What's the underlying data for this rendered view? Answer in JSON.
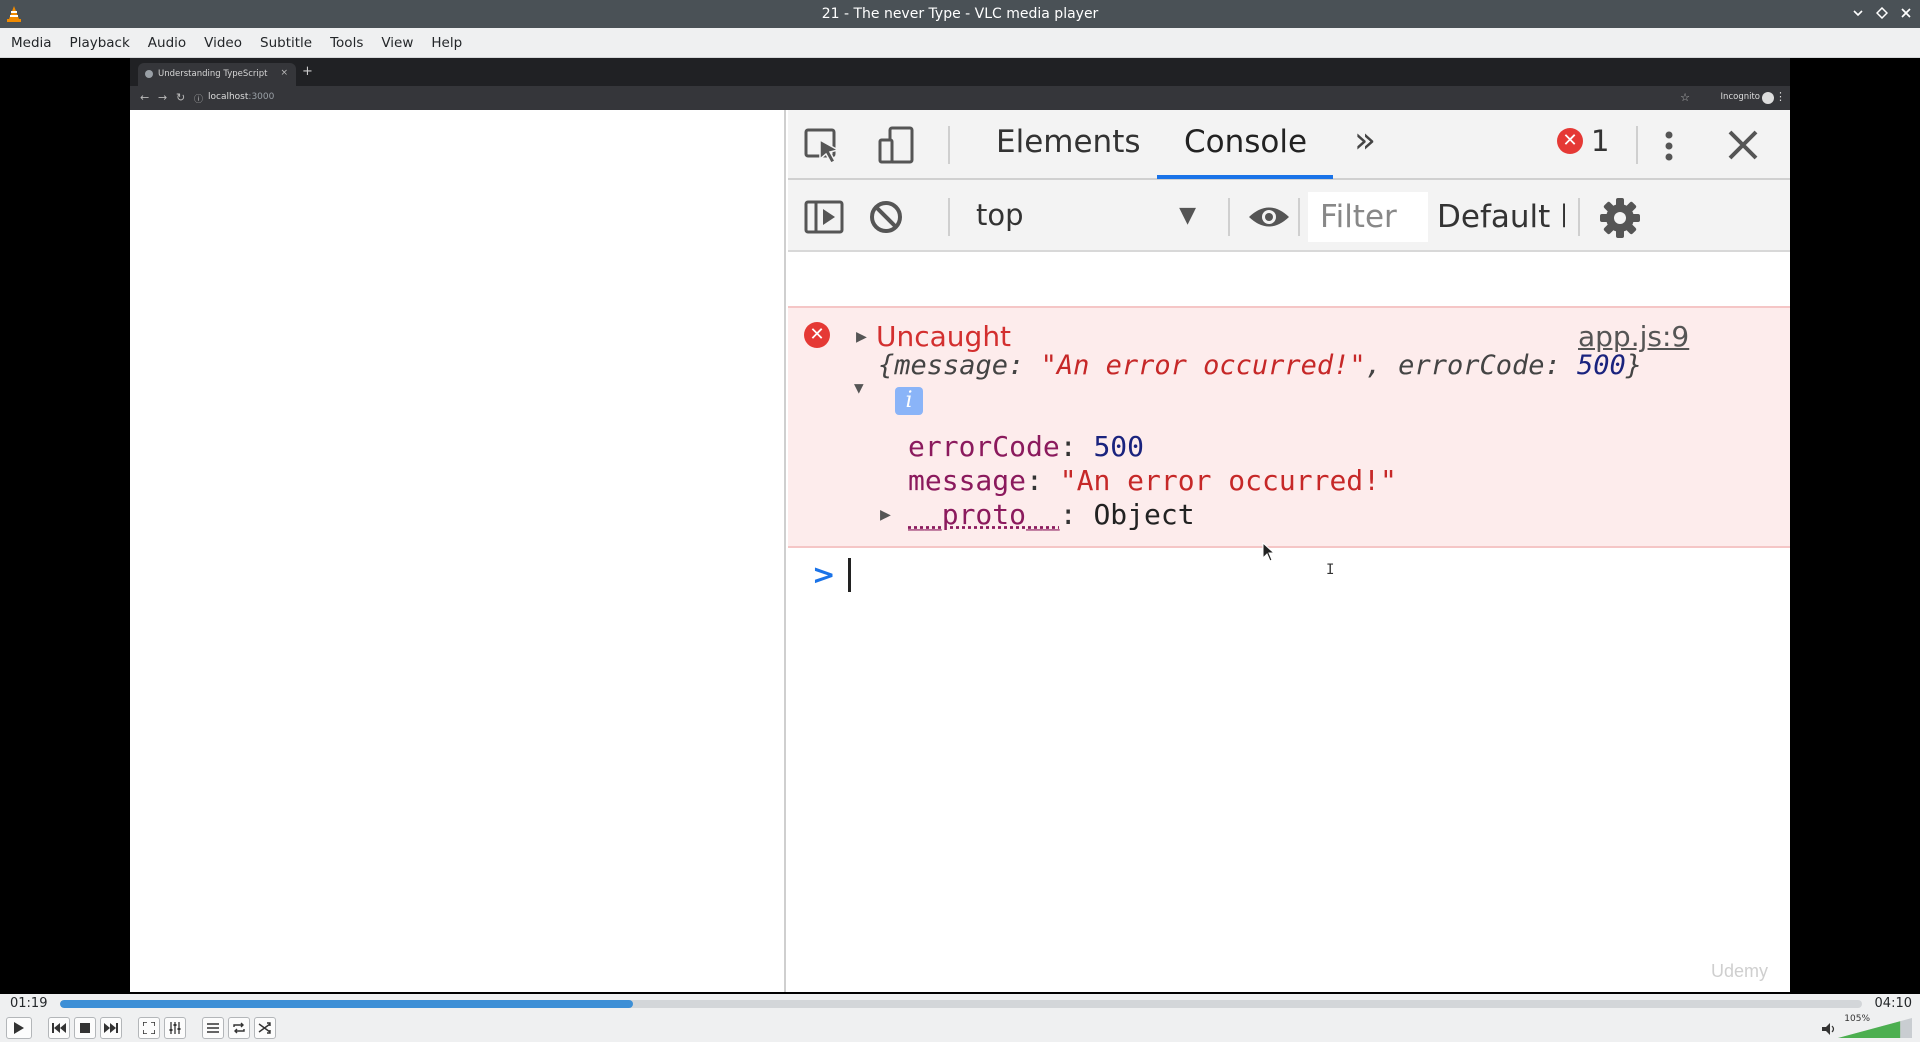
{
  "window": {
    "title": "21 - The never Type - VLC media player"
  },
  "menubar": {
    "items": [
      "Media",
      "Playback",
      "Audio",
      "Video",
      "Subtitle",
      "Tools",
      "View",
      "Help"
    ]
  },
  "browser": {
    "tab_title": "Understanding TypeScript",
    "tab_close": "×",
    "new_tab": "+",
    "url_host": "localhost",
    "url_port": ":3000",
    "incognito_label": "Incognito"
  },
  "devtools": {
    "tabs": [
      "Elements",
      "Console"
    ],
    "active_tab": "Console",
    "more_tabs": "»",
    "error_count": "1",
    "context": "top",
    "filter_placeholder": "Filter",
    "levels": "Default levels",
    "console": {
      "error_label": "Uncaught",
      "source_link": "app.js:9",
      "object_summary": {
        "open": "{message: ",
        "message": "\"An error occurred!\"",
        "mid": ", errorCode: ",
        "code": "500",
        "close": "}"
      },
      "info_badge": "i",
      "props": [
        {
          "key": "errorCode",
          "sep": ": ",
          "value": "500",
          "kind": "num"
        },
        {
          "key": "message",
          "sep": ": ",
          "value": "\"An error occurred!\"",
          "kind": "str"
        },
        {
          "key": "__proto__",
          "sep": ": ",
          "value": "Object",
          "kind": "plain"
        }
      ],
      "prompt": ">"
    }
  },
  "watermark": "Udemy",
  "player": {
    "elapsed": "01:19",
    "total": "04:10",
    "progress": 0.318,
    "volume_label": "105%",
    "volume": 1.05
  },
  "colors": {
    "accent": "#3d8fd6",
    "error": "#e53935",
    "devtools_active": "#1a73e8"
  }
}
